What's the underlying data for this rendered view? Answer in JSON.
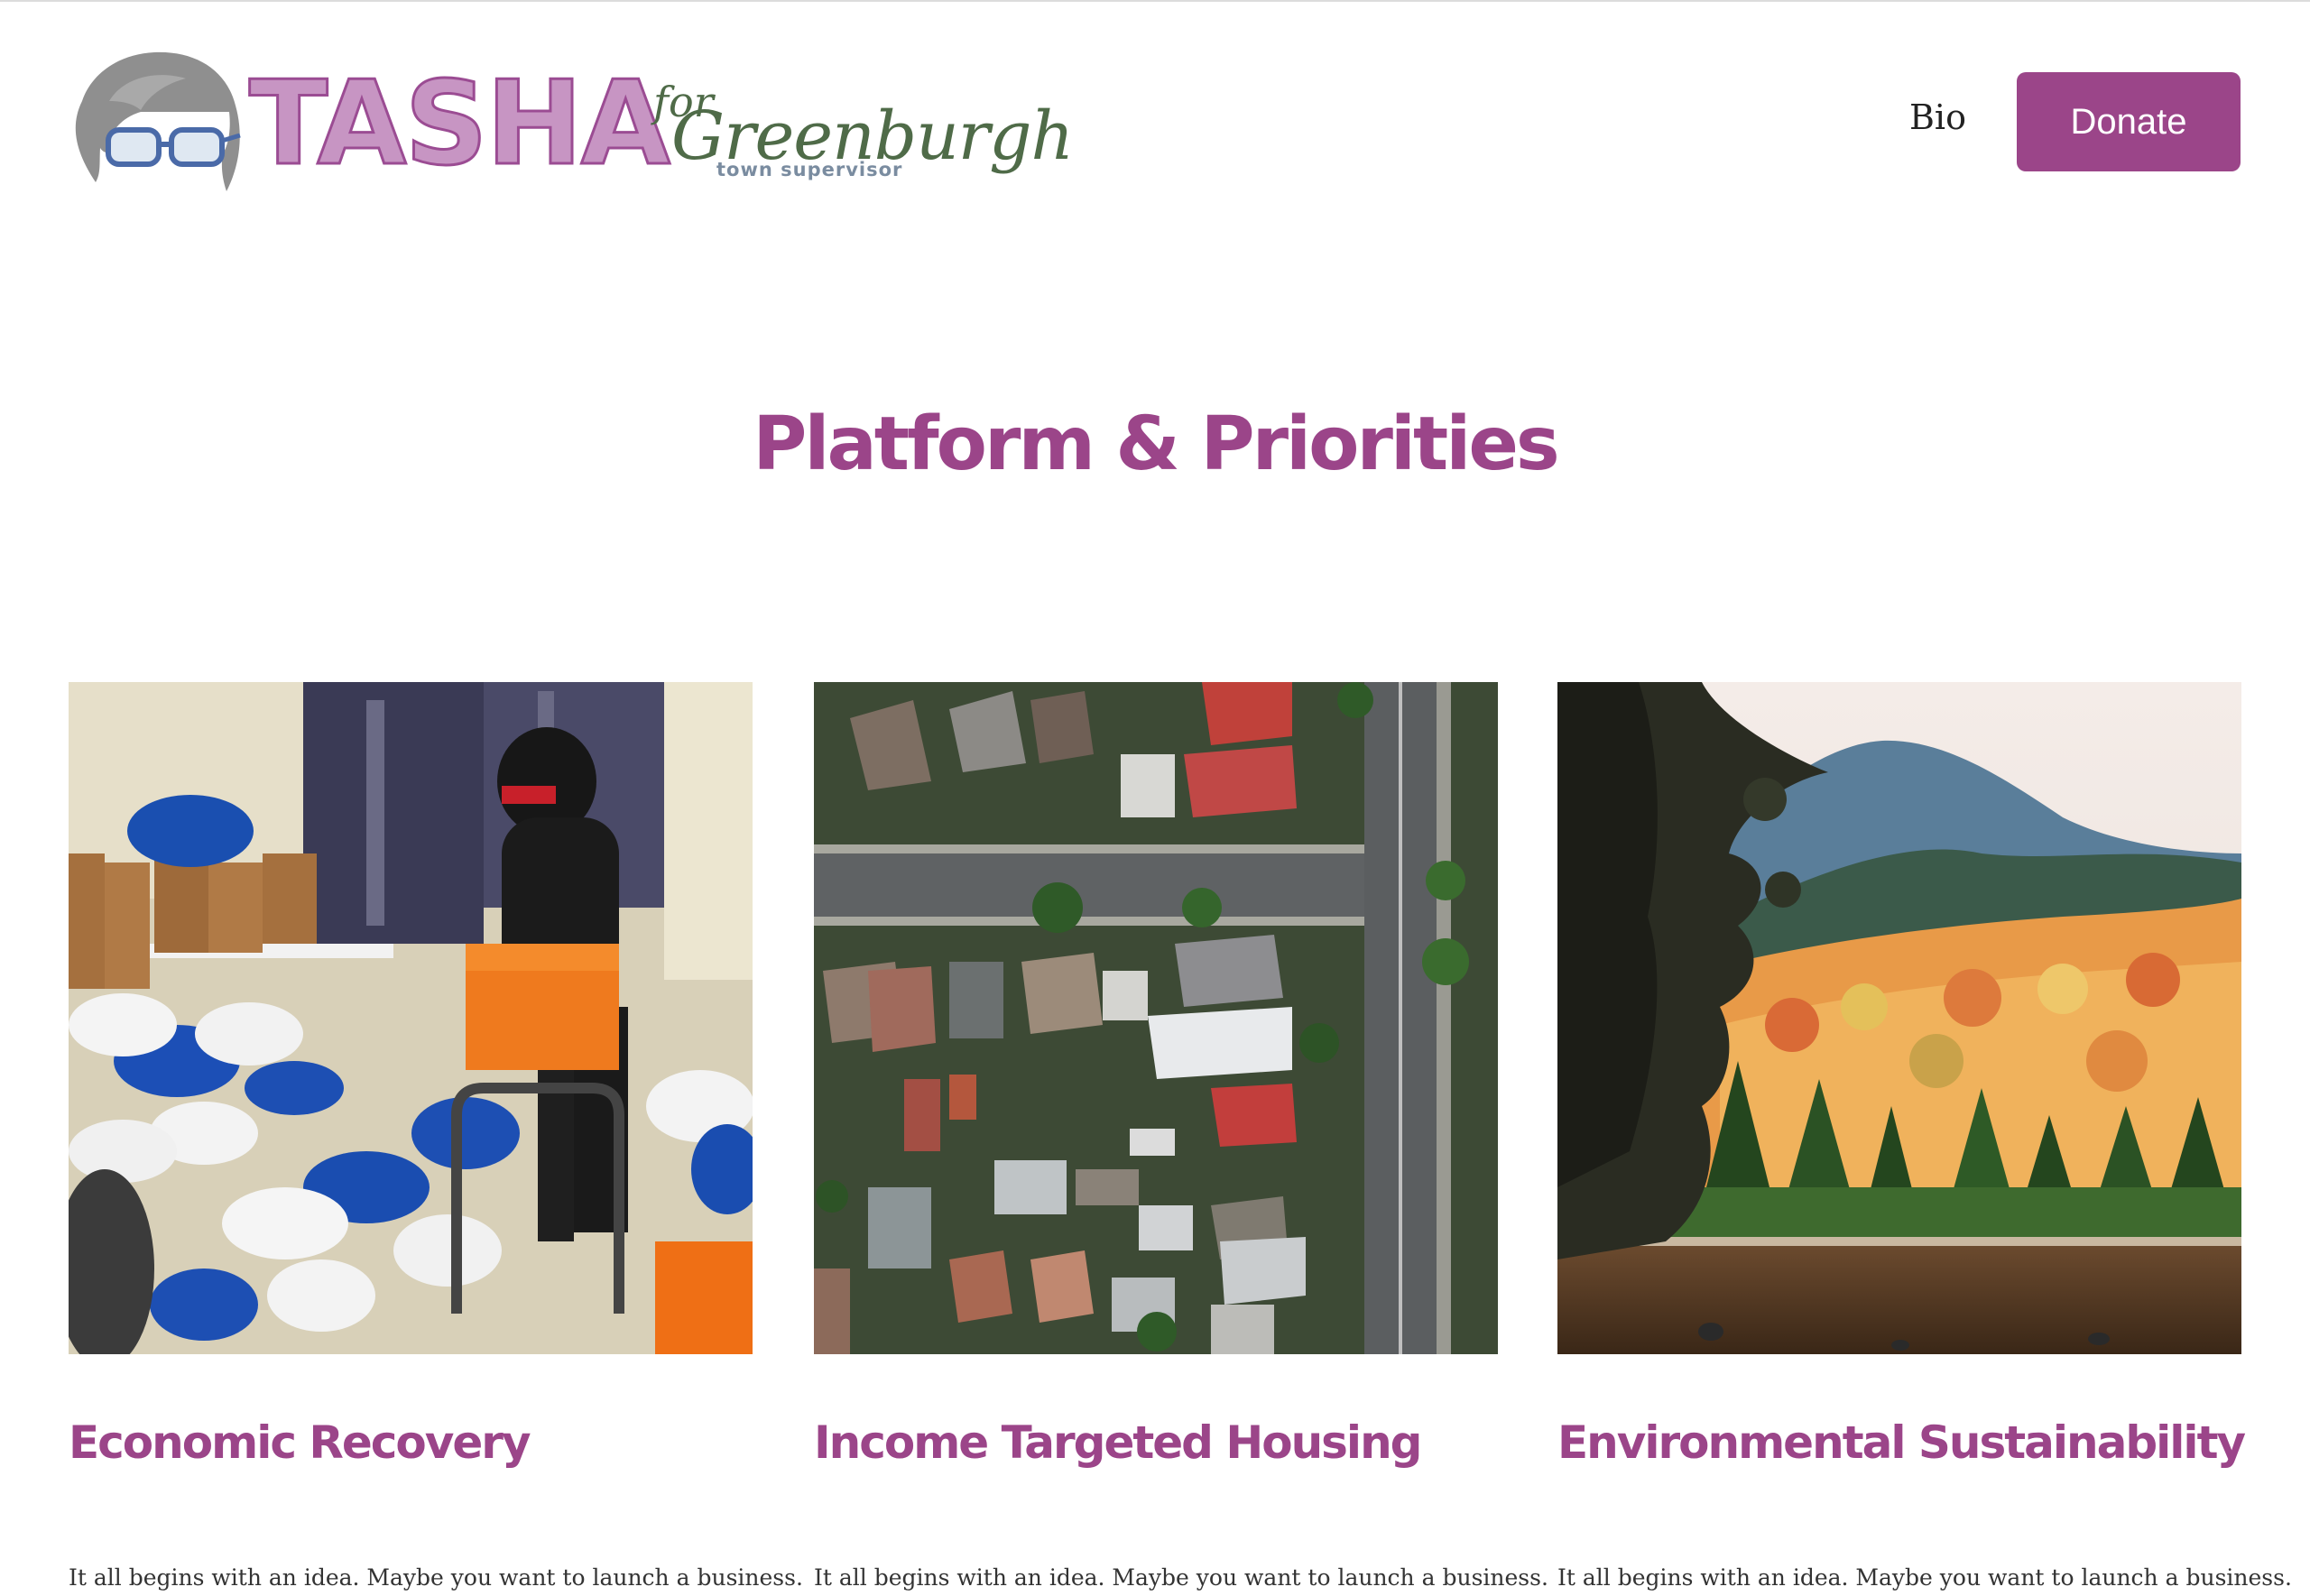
{
  "header": {
    "logo": {
      "name": "TASHA",
      "for": "for",
      "place": "Greenburgh",
      "tagline": "town supervisor"
    },
    "nav": {
      "bio_label": "Bio",
      "donate_label": "Donate"
    }
  },
  "main": {
    "title": "Platform & Priorities",
    "cards": [
      {
        "title": "Economic Recovery",
        "text": "It all begins with an idea. Maybe you want to launch a business."
      },
      {
        "title": "Income Targeted Housing",
        "text": "It all begins with an idea. Maybe you want to launch a business."
      },
      {
        "title": "Environmental Sustainability",
        "text": "It all begins with an idea. Maybe you want to launch a business."
      }
    ]
  },
  "colors": {
    "brand_purple": "#9b4589",
    "logo_pink": "#c795c3",
    "logo_green": "#4f6b48"
  }
}
